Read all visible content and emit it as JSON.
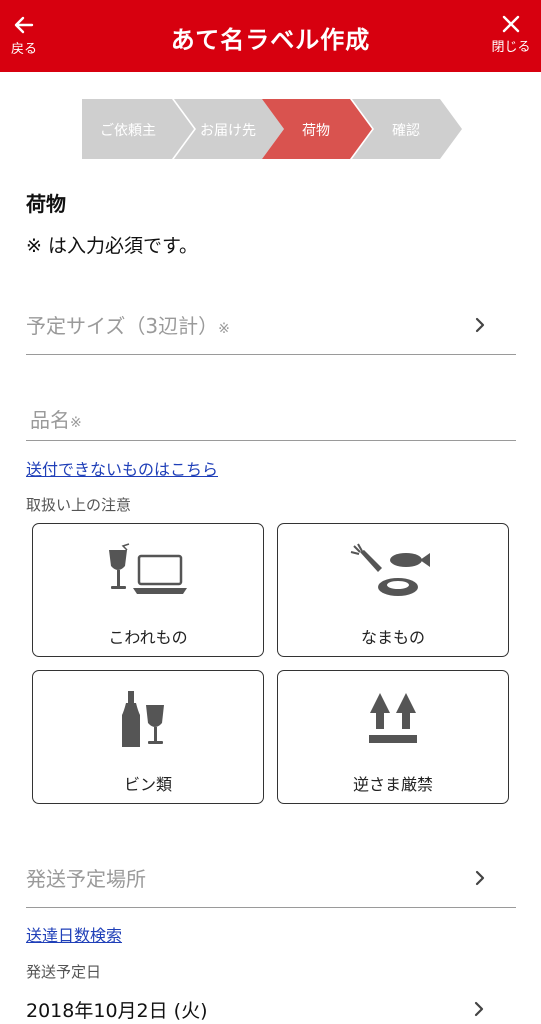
{
  "header": {
    "back_label": "戻る",
    "title": "あて名ラベル作成",
    "close_label": "閉じる",
    "background": "#d7000f"
  },
  "stepper": {
    "steps": [
      {
        "label": "ご依頼主",
        "state": "inactive"
      },
      {
        "label": "お届け先",
        "state": "inactive"
      },
      {
        "label": "荷物",
        "state": "active"
      },
      {
        "label": "確認",
        "state": "inactive"
      }
    ],
    "active_color": "#d9534f",
    "inactive_color": "#cfcfcf"
  },
  "page": {
    "section_title": "荷物",
    "required_note": "※ は入力必須です。"
  },
  "size_field": {
    "placeholder": "予定サイズ（3辺計）",
    "required_mark": "※"
  },
  "item_field": {
    "placeholder": "品名",
    "required_mark": "※"
  },
  "links": {
    "prohibited_items": "送付できないものはこちら",
    "delivery_days_search": "送達日数検索"
  },
  "handling": {
    "label": "取扱い上の注意",
    "options": [
      {
        "label": "こわれもの",
        "icon": "fragile-icon"
      },
      {
        "label": "なまもの",
        "icon": "perishable-icon"
      },
      {
        "label": "ビン類",
        "icon": "bottles-icon"
      },
      {
        "label": "逆さま厳禁",
        "icon": "this-side-up-icon"
      }
    ]
  },
  "shipping_place": {
    "placeholder": "発送予定場所"
  },
  "shipping_date": {
    "label": "発送予定日",
    "value": "2018年10月2日 (火)"
  }
}
